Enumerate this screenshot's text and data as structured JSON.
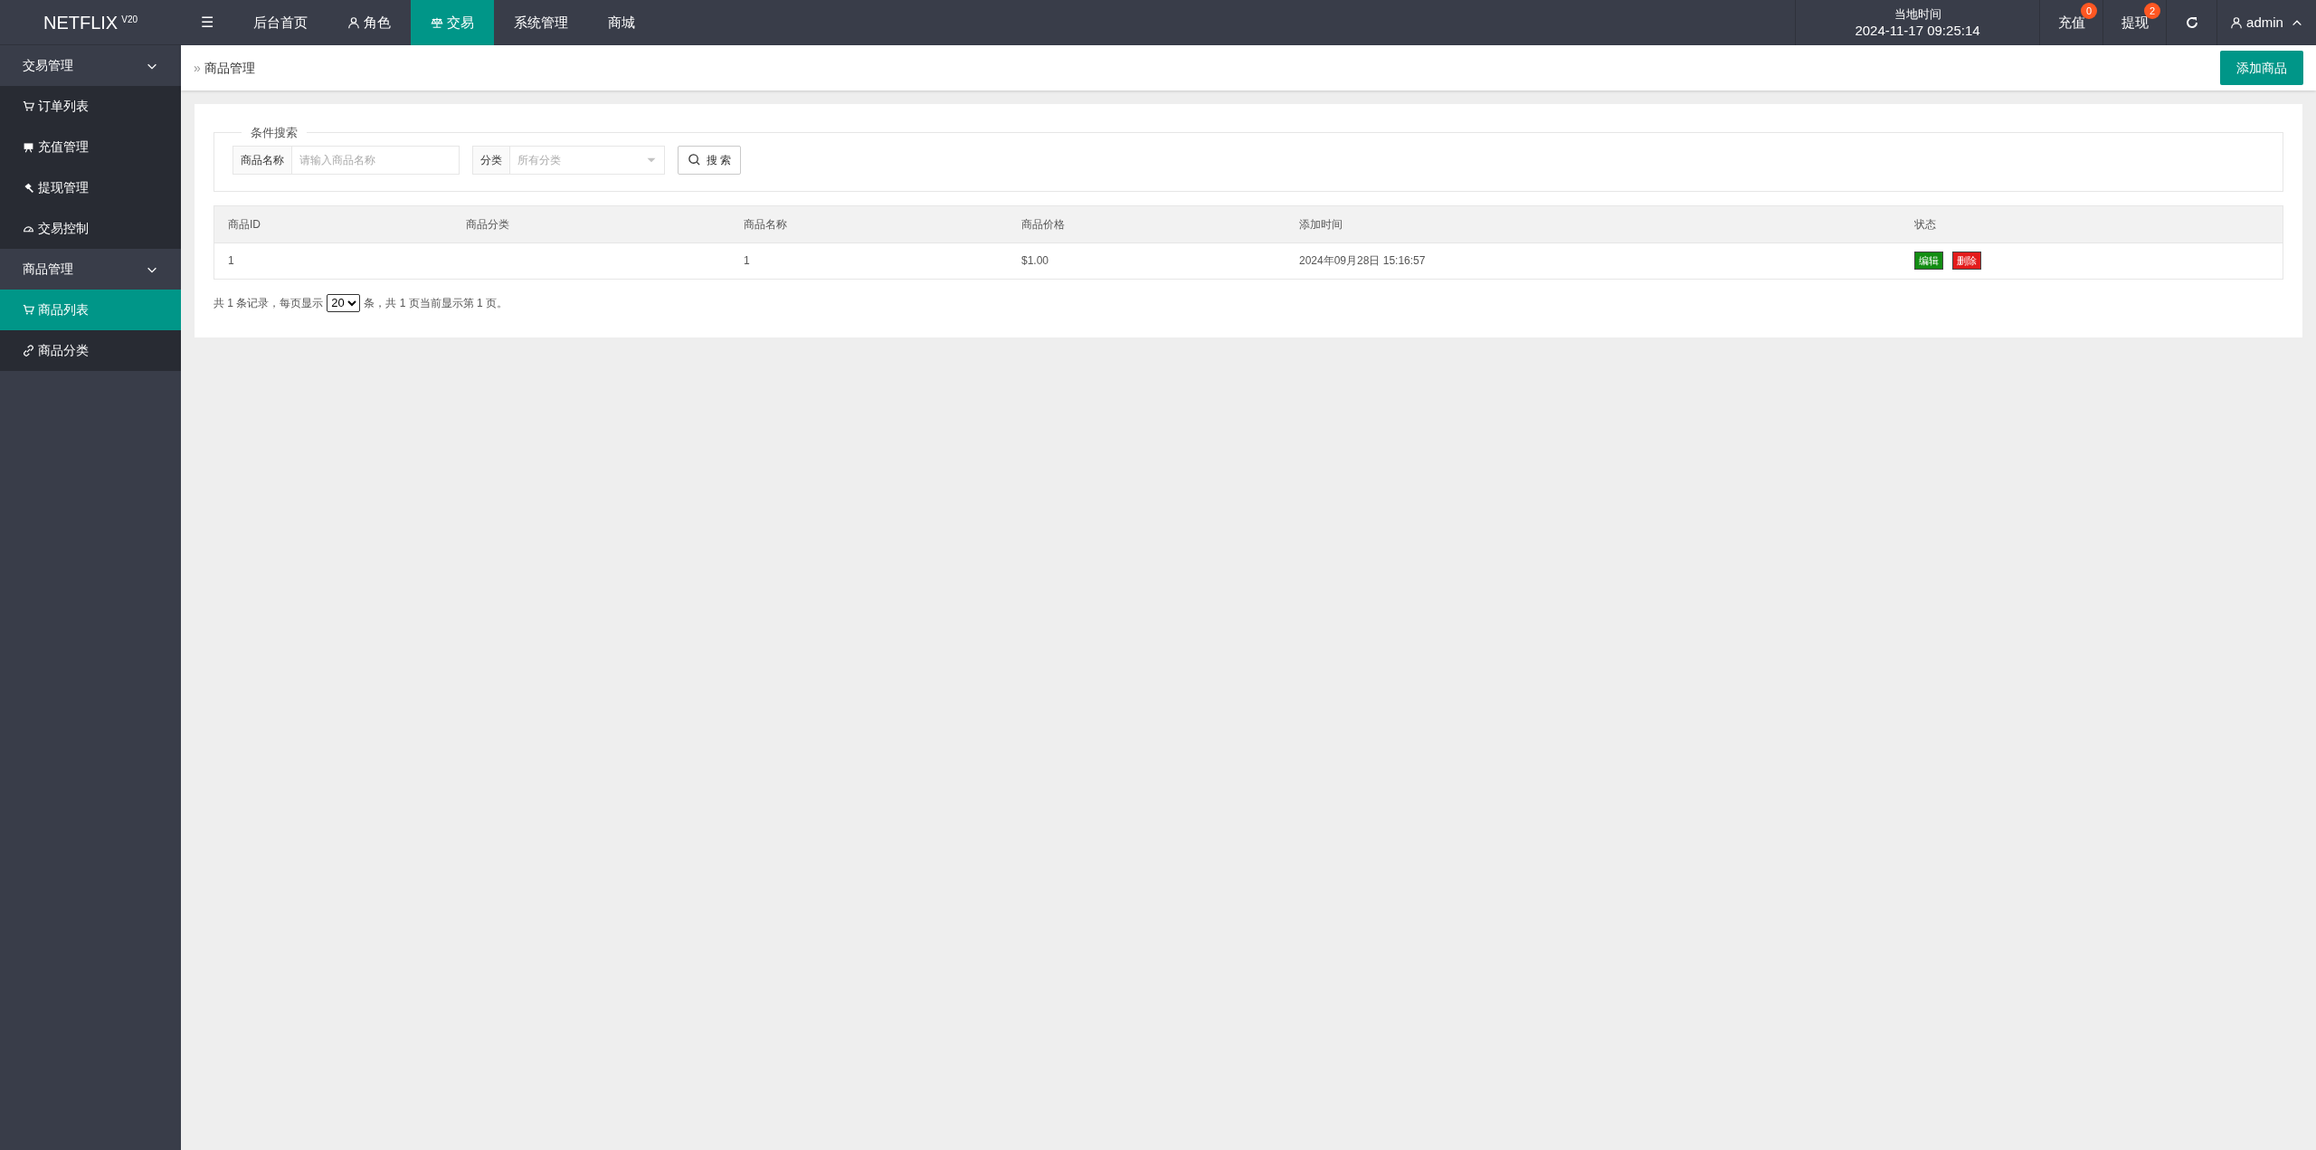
{
  "logo": {
    "text": "NETFLIX",
    "version": "V20"
  },
  "menu_toggle": "☰",
  "nav": [
    {
      "label": "后台首页",
      "selected": false
    },
    {
      "label": "角色",
      "selected": false
    },
    {
      "label": "交易",
      "selected": true
    },
    {
      "label": "系统管理",
      "selected": false
    },
    {
      "label": "商城",
      "selected": false
    }
  ],
  "clock": {
    "label": "当地时间",
    "time": "2024-11-17 09:25:14"
  },
  "header_actions": [
    {
      "kind": "badge",
      "label": "充值",
      "count": "0"
    },
    {
      "kind": "badge",
      "label": "提现",
      "count": "2"
    },
    {
      "kind": "refresh"
    }
  ],
  "user": {
    "name": "admin",
    "expanded": true
  },
  "sidebar": [
    {
      "label": "交易管理",
      "expanded": true,
      "children": [
        {
          "label": "订单列表",
          "selected": false
        },
        {
          "label": "充值管理",
          "selected": false
        },
        {
          "label": "提现管理",
          "selected": false
        },
        {
          "label": "交易控制",
          "selected": false
        }
      ]
    },
    {
      "label": "商品管理",
      "expanded": true,
      "children": [
        {
          "label": "商品列表",
          "selected": true
        },
        {
          "label": "商品分类",
          "selected": false
        }
      ]
    }
  ],
  "breadcrumb": {
    "separator": "»",
    "current": "商品管理"
  },
  "add_button": "添加商品",
  "search": {
    "legend": "条件搜索",
    "name_label": "商品名称",
    "name_placeholder": "请输入商品名称",
    "category_label": "分类",
    "category_placeholder": "所有分类",
    "button": "搜 索"
  },
  "table": {
    "columns": [
      "商品ID",
      "商品分类",
      "商品名称",
      "商品价格",
      "添加时间",
      "状态"
    ],
    "rows": [
      {
        "id": "1",
        "category": "",
        "name": "1",
        "price": "$1.00",
        "added": "2024年09月28日 15:16:57",
        "actions": [
          "编辑",
          "删除"
        ]
      }
    ]
  },
  "pagination": {
    "before": "共 1 条记录，每页显示",
    "page_size": "20",
    "after": "条，共 1 页当前显示第 1 页。"
  }
}
